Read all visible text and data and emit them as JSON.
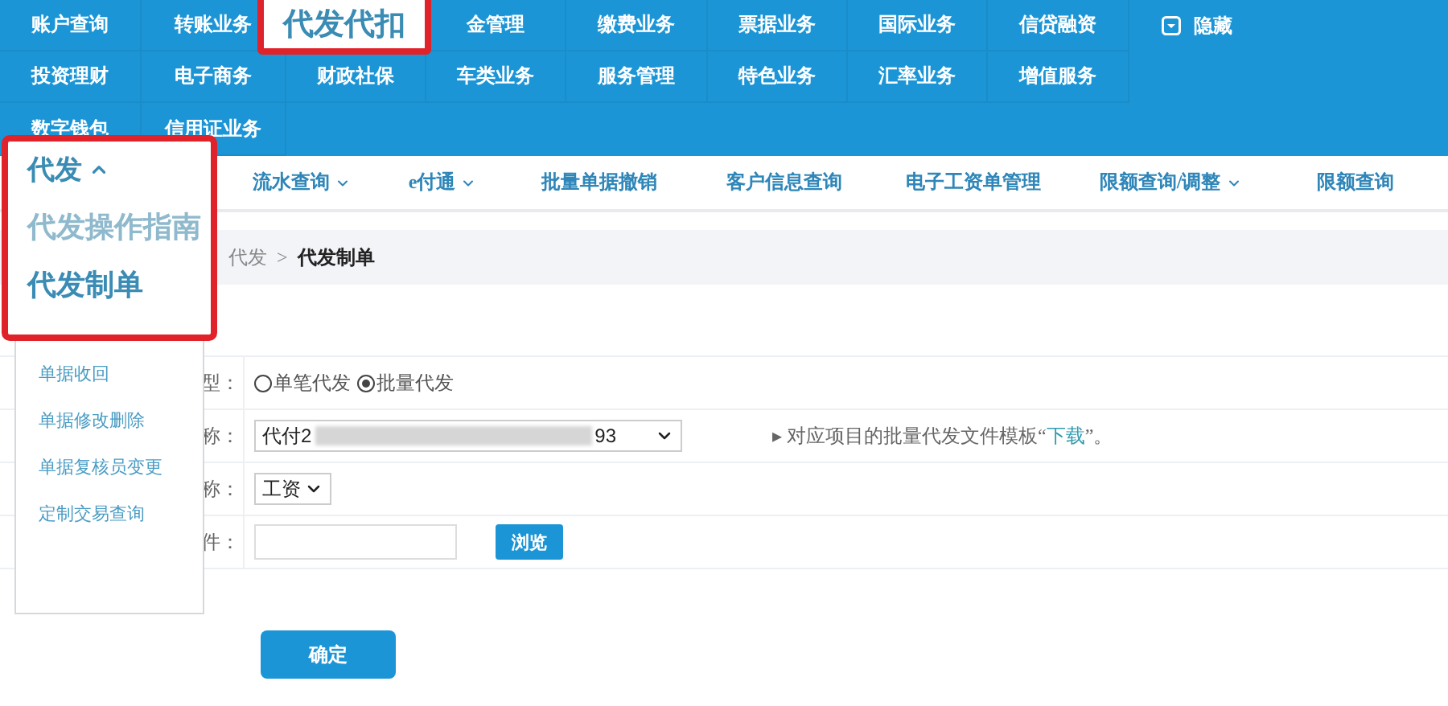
{
  "top_nav": {
    "rows": [
      [
        {
          "label": "账户查询",
          "kind": "plain"
        },
        {
          "label": "转账业务",
          "kind": "plain"
        },
        {
          "label": "代发代扣",
          "kind": "highlighted"
        },
        {
          "label": "金管理",
          "kind": "plain"
        },
        {
          "label": "缴费业务",
          "kind": "plain"
        },
        {
          "label": "票据业务",
          "kind": "plain"
        },
        {
          "label": "国际业务",
          "kind": "plain"
        },
        {
          "label": "信贷融资",
          "kind": "plain"
        }
      ],
      [
        {
          "label": "投资理财",
          "kind": "plain"
        },
        {
          "label": "电子商务",
          "kind": "plain"
        },
        {
          "label": "财政社保",
          "kind": "plain"
        },
        {
          "label": "车类业务",
          "kind": "plain"
        },
        {
          "label": "服务管理",
          "kind": "plain"
        },
        {
          "label": "特色业务",
          "kind": "plain"
        },
        {
          "label": "汇率业务",
          "kind": "plain"
        },
        {
          "label": "增值服务",
          "kind": "plain"
        }
      ],
      [
        {
          "label": "数字钱包",
          "kind": "plain"
        },
        {
          "label": "信用证业务",
          "kind": "plain"
        }
      ]
    ],
    "hide_toggle": {
      "label": "隐藏"
    }
  },
  "sub_nav": [
    {
      "label": "流水查询",
      "has_dropdown": true
    },
    {
      "label": "e付通",
      "has_dropdown": true
    },
    {
      "label": "批量单据撤销",
      "has_dropdown": false
    },
    {
      "label": "客户信息查询",
      "has_dropdown": false
    },
    {
      "label": "电子工资单管理",
      "has_dropdown": false
    },
    {
      "label": "限额查询/调整",
      "has_dropdown": true
    },
    {
      "label": "限额查询",
      "has_dropdown": false
    }
  ],
  "dropdown": {
    "title": "代发",
    "expanded": true,
    "items": [
      {
        "label": "代发操作指南",
        "kind": "callout",
        "selected": false
      },
      {
        "label": "代发制单",
        "kind": "callout",
        "selected": true
      },
      {
        "label": "单据收回",
        "kind": "plain",
        "selected": false
      },
      {
        "label": "单据修改删除",
        "kind": "plain",
        "selected": false
      },
      {
        "label": "单据复核员变更",
        "kind": "plain",
        "selected": false
      },
      {
        "label": "定制交易查询",
        "kind": "plain",
        "selected": false
      }
    ]
  },
  "breadcrumb": {
    "items": [
      "代发",
      "代发制单"
    ],
    "separator": ">"
  },
  "form": {
    "rows": [
      {
        "label": "型：",
        "kind": "radio",
        "options": [
          {
            "label": "单笔代发",
            "selected": false
          },
          {
            "label": "批量代发",
            "selected": true
          }
        ]
      },
      {
        "label": "称：",
        "kind": "select",
        "value_parts": [
          "代付2",
          "93"
        ],
        "hint": {
          "marker": "▸",
          "before": "对应项目的批量代发文件模板“",
          "link": "下载",
          "after": "”。"
        }
      },
      {
        "label": "称：",
        "kind": "select",
        "value_parts": [
          "工资"
        ]
      },
      {
        "label": "件：",
        "kind": "file",
        "button": "浏览"
      }
    ]
  },
  "submit": "确定"
}
